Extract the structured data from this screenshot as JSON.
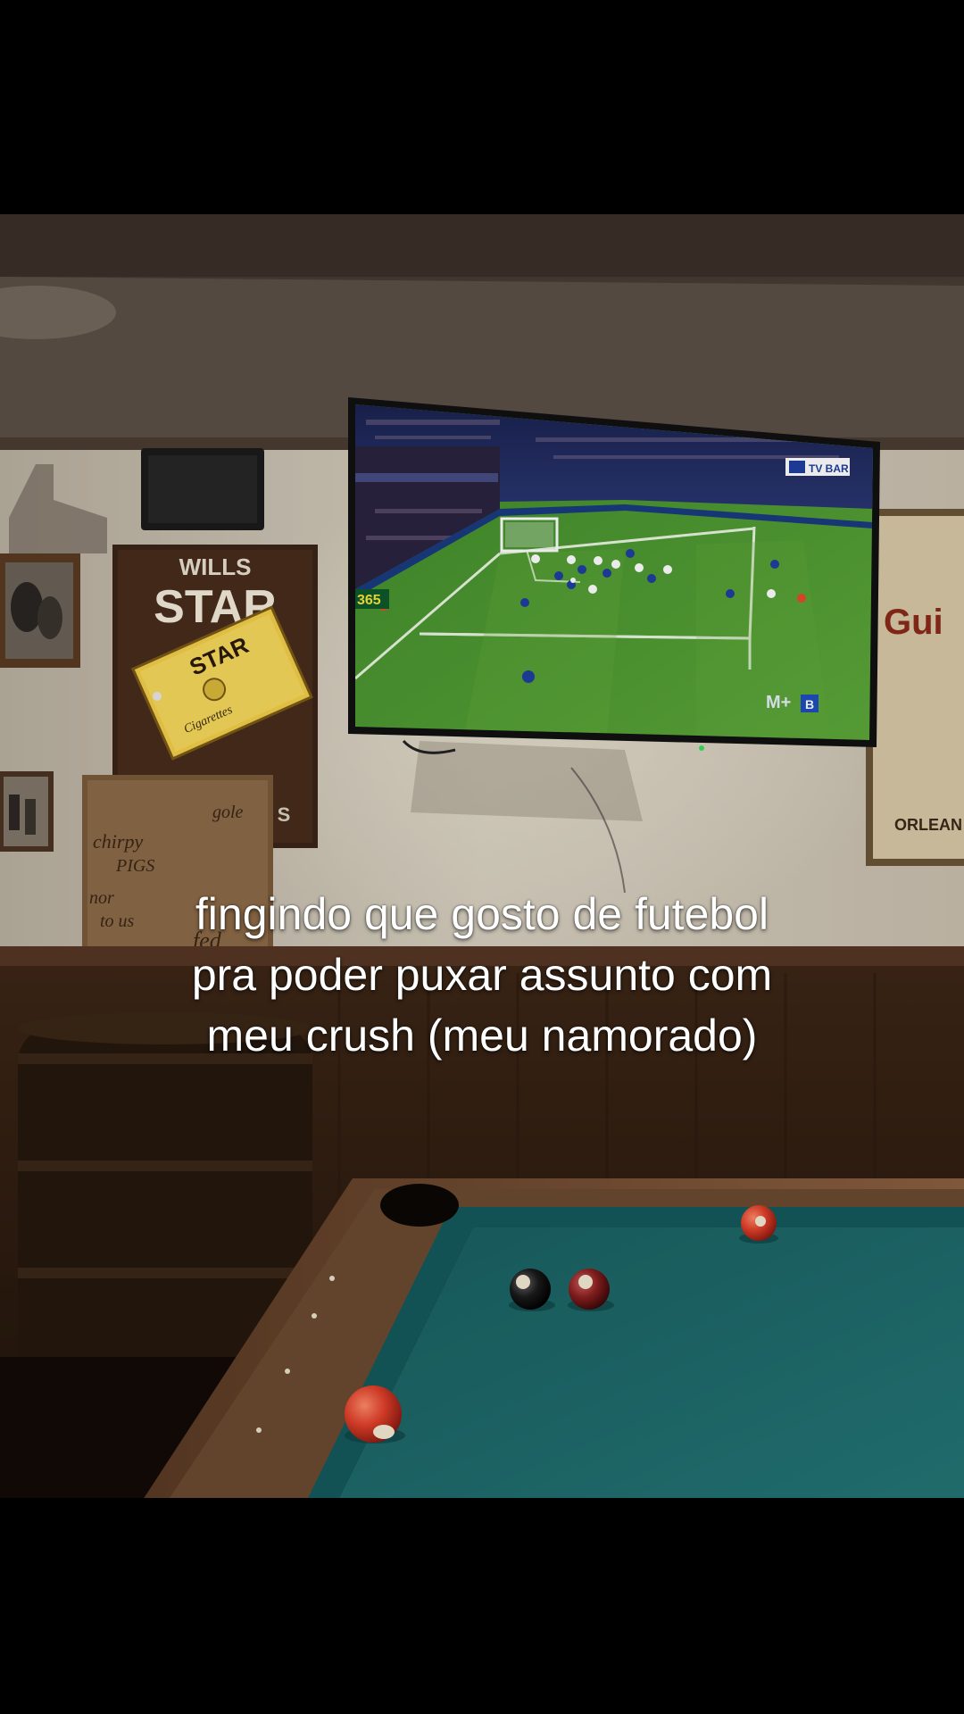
{
  "caption": {
    "lines": [
      "fingindo que gosto de futebol",
      "pra poder puxar assunto com",
      "meu crush (meu namorado)"
    ]
  },
  "scene": {
    "wills_sign": {
      "brand_top": "WILLS",
      "brand_main": "STAR",
      "pack_label": "STAR",
      "pack_sub": "Cigarettes",
      "bottom_letter": "S"
    },
    "wooden_sign_text": [
      "chirpy",
      "PIGS",
      "nor",
      "to us",
      "gole",
      "fed"
    ],
    "tv": {
      "scoreboard_brand": "TV BAR",
      "left_ad": "365",
      "channel_logo": "M+",
      "channel_badge": "B"
    },
    "right_poster_text": [
      "Gui",
      "ORLEAN"
    ],
    "colors": {
      "felt": "#1f6b6c",
      "pitch": "#4f9a2e",
      "wall": "#cfc7b7",
      "wood": "#3b2415"
    }
  }
}
